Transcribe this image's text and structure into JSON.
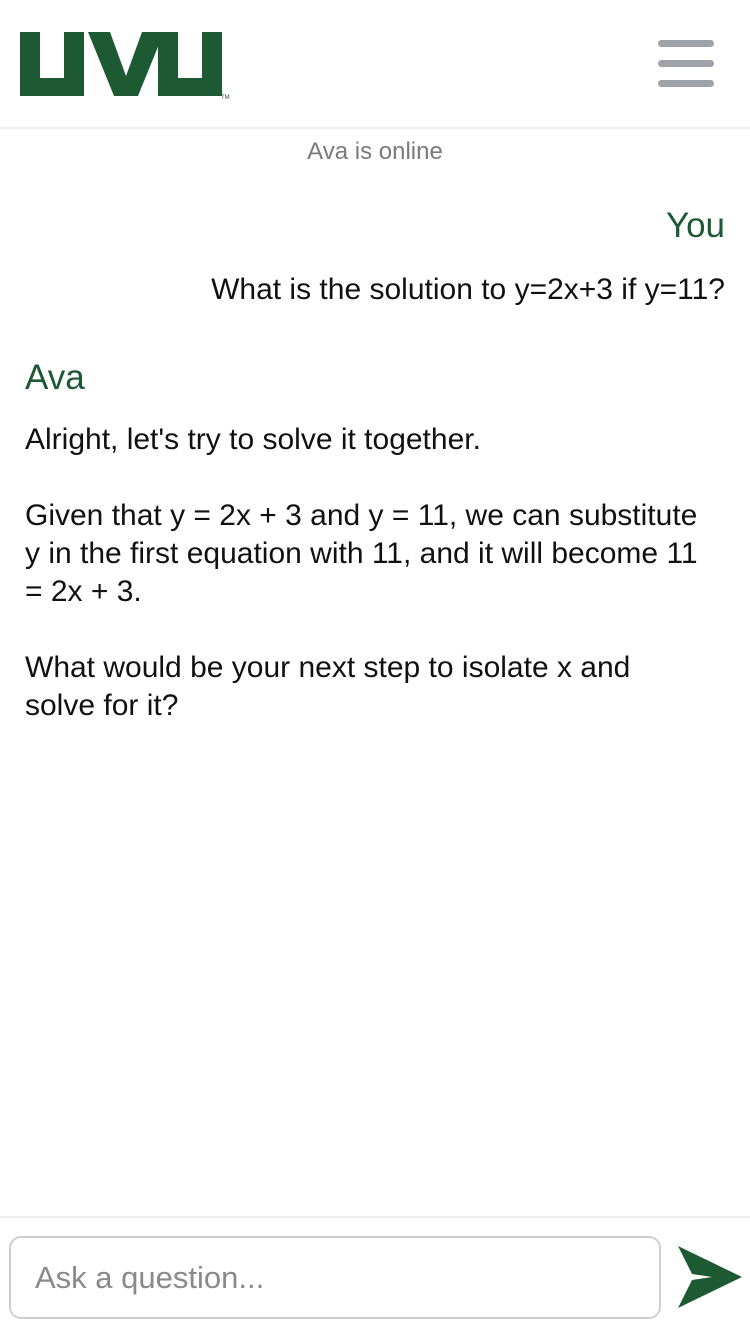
{
  "header": {
    "logo_text": "UVU",
    "logo_trademark": "TM",
    "brand_color": "#1d5a34",
    "menu_icon": "hamburger-menu-icon"
  },
  "status": {
    "text": "Ava is online"
  },
  "messages": [
    {
      "sender": "You",
      "text": "What is the solution to y=2x+3 if y=11?"
    },
    {
      "sender": "Ava",
      "paragraphs": [
        "Alright, let's try to solve it together.",
        "Given that y = 2x + 3 and y = 11, we can substitute y in the first equation with 11, and it will become 11 = 2x + 3.",
        "What would be your next step to isolate x and solve for it?"
      ]
    }
  ],
  "composer": {
    "placeholder": "Ask a question...",
    "value": "",
    "send_icon": "send-arrow-icon"
  }
}
